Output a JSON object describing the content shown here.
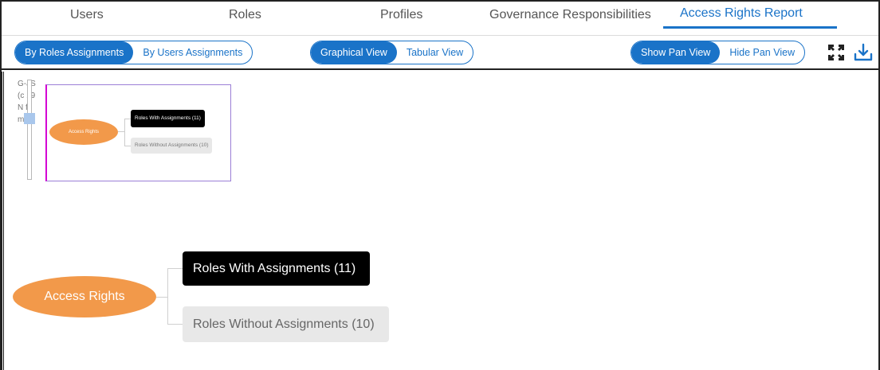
{
  "tabs": [
    {
      "label": "Users",
      "active": false
    },
    {
      "label": "Roles",
      "active": false
    },
    {
      "label": "Profiles",
      "active": false
    },
    {
      "label": "Governance Responsibilities",
      "active": false
    },
    {
      "label": "Access Rights Report",
      "active": true
    }
  ],
  "toolbar": {
    "assignment_toggle": {
      "options": [
        "By Roles Assignments",
        "By Users Assignments"
      ],
      "selected": "By Roles Assignments"
    },
    "view_toggle": {
      "options": [
        "Graphical View",
        "Tabular View"
      ],
      "selected": "Graphical View"
    },
    "pan_toggle": {
      "options": [
        "Show Pan View",
        "Hide Pan View"
      ],
      "selected": "Show Pan View"
    },
    "fullscreen_icon": "expand-icon",
    "download_icon": "download-icon"
  },
  "background_text": [
    "G-JS",
    "(c 19",
    "N fo",
    "m oo"
  ],
  "diagram": {
    "root": "Access Rights",
    "children": [
      {
        "label": "Roles With Assignments (11)",
        "style": "dark"
      },
      {
        "label": "Roles Without Assignments (10)",
        "style": "light"
      }
    ]
  },
  "colors": {
    "accent": "#1a73c8",
    "root_node": "#f2994a",
    "dark_node": "#000000",
    "light_node": "#e8e8e8"
  }
}
